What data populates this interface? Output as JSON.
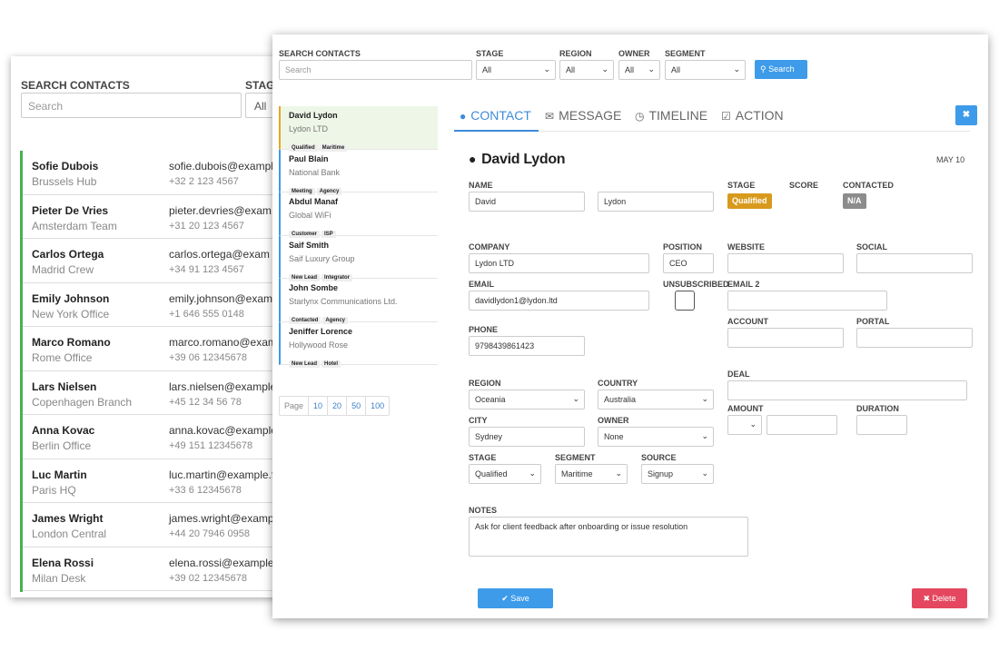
{
  "back": {
    "search_label": "SEARCH CONTACTS",
    "search_placeholder": "Search",
    "stage_label": "STAG",
    "stage_value": "All",
    "contacts": [
      {
        "name": "Sofie Dubois",
        "org": "Brussels Hub",
        "email": "sofie.dubois@exampl",
        "phone": "+32 2 123 4567"
      },
      {
        "name": "Pieter De Vries",
        "org": "Amsterdam Team",
        "email": "pieter.devries@exam",
        "phone": "+31 20 123 4567"
      },
      {
        "name": "Carlos Ortega",
        "org": "Madrid Crew",
        "email": "carlos.ortega@exam",
        "phone": "+34 91 123 4567"
      },
      {
        "name": "Emily Johnson",
        "org": "New York Office",
        "email": "emily.johnson@exam",
        "phone": "+1 646 555 0148"
      },
      {
        "name": "Marco Romano",
        "org": "Rome Office",
        "email": "marco.romano@exam",
        "phone": "+39 06 12345678"
      },
      {
        "name": "Lars Nielsen",
        "org": "Copenhagen Branch",
        "email": "lars.nielsen@example",
        "phone": "+45 12 34 56 78"
      },
      {
        "name": "Anna Kovac",
        "org": "Berlin Office",
        "email": "anna.kovac@example",
        "phone": "+49 151 12345678"
      },
      {
        "name": "Luc Martin",
        "org": "Paris HQ",
        "email": "luc.martin@example.f",
        "phone": "+33 6 12345678"
      },
      {
        "name": "James Wright",
        "org": "London Central",
        "email": "james.wright@examp",
        "phone": "+44 20 7946 0958"
      },
      {
        "name": "Elena Rossi",
        "org": "Milan Desk",
        "email": "elena.rossi@example",
        "phone": "+39 02 12345678"
      }
    ]
  },
  "front": {
    "filters": {
      "search_label": "SEARCH CONTACTS",
      "search_placeholder": "Search",
      "stage_label": "STAGE",
      "stage_value": "All",
      "region_label": "REGION",
      "region_value": "All",
      "owner_label": "OWNER",
      "owner_value": "All",
      "segment_label": "SEGMENT",
      "segment_value": "All",
      "search_button": "Search"
    },
    "contacts": [
      {
        "name": "David Lydon",
        "company": "Lydon LTD",
        "tags": [
          "Qualified",
          "Maritime"
        ]
      },
      {
        "name": "Paul Blain",
        "company": "National Bank",
        "tags": [
          "Meeting",
          "Agency"
        ]
      },
      {
        "name": "Abdul Manaf",
        "company": "Global WiFi",
        "tags": [
          "Customer",
          "ISP"
        ]
      },
      {
        "name": "Saif Smith",
        "company": "Saif Luxury Group",
        "tags": [
          "New Lead",
          "Integrator"
        ]
      },
      {
        "name": "John Sombe",
        "company": "Starlynx Communications Ltd.",
        "tags": [
          "Contacted",
          "Agency"
        ]
      },
      {
        "name": "Jeniffer Lorence",
        "company": "Hollywood Rose",
        "tags": [
          "New Lead",
          "Hotel"
        ]
      }
    ],
    "pager": {
      "label": "Page",
      "sizes": [
        "10",
        "20",
        "50",
        "100"
      ]
    },
    "tabs": [
      {
        "label": "CONTACT",
        "icon": "user-icon",
        "active": true
      },
      {
        "label": "MESSAGE",
        "icon": "envelope-icon",
        "active": false
      },
      {
        "label": "TIMELINE",
        "icon": "clock-icon",
        "active": false
      },
      {
        "label": "ACTION",
        "icon": "check-square-icon",
        "active": false
      }
    ],
    "detail": {
      "title": "David Lydon",
      "date": "MAY 10",
      "name_label": "NAME",
      "first_name": "David",
      "last_name": "Lydon",
      "stage_label": "STAGE",
      "stage_value": "Qualified",
      "score_label": "SCORE",
      "contacted_label": "CONTACTED",
      "contacted_value": "N/A",
      "company_label": "COMPANY",
      "company_value": "Lydon LTD",
      "position_label": "POSITION",
      "position_value": "CEO",
      "website_label": "WEBSITE",
      "social_label": "SOCIAL",
      "email_label": "EMAIL",
      "email_value": "davidlydon1@lydon.ltd",
      "unsubscribed_label": "UNSUBSCRIBED",
      "email2_label": "EMAIL 2",
      "account_label": "ACCOUNT",
      "portal_label": "PORTAL",
      "phone_label": "PHONE",
      "phone_value": "9798439861423",
      "deal_label": "DEAL",
      "region_label": "REGION",
      "region_value": "Oceania",
      "country_label": "COUNTRY",
      "country_value": "Australia",
      "amount_label": "AMOUNT",
      "duration_label": "DURATION",
      "city_label": "CITY",
      "city_value": "Sydney",
      "owner_label": "OWNER",
      "owner_value": "None",
      "stage2_label": "STAGE",
      "stage2_value": "Qualified",
      "segment_label": "SEGMENT",
      "segment_value": "Maritime",
      "source_label": "SOURCE",
      "source_value": "Signup",
      "notes_label": "NOTES",
      "notes_value": "Ask for client feedback after onboarding or issue resolution",
      "save_button": "Save",
      "delete_button": "Delete"
    },
    "colors": {
      "accent": "#3d9be9",
      "stage_badge": "#d89a1d",
      "contacted_badge": "#8c8c8c",
      "delete": "#e4475f",
      "selected_row": "#eef6e7"
    }
  }
}
